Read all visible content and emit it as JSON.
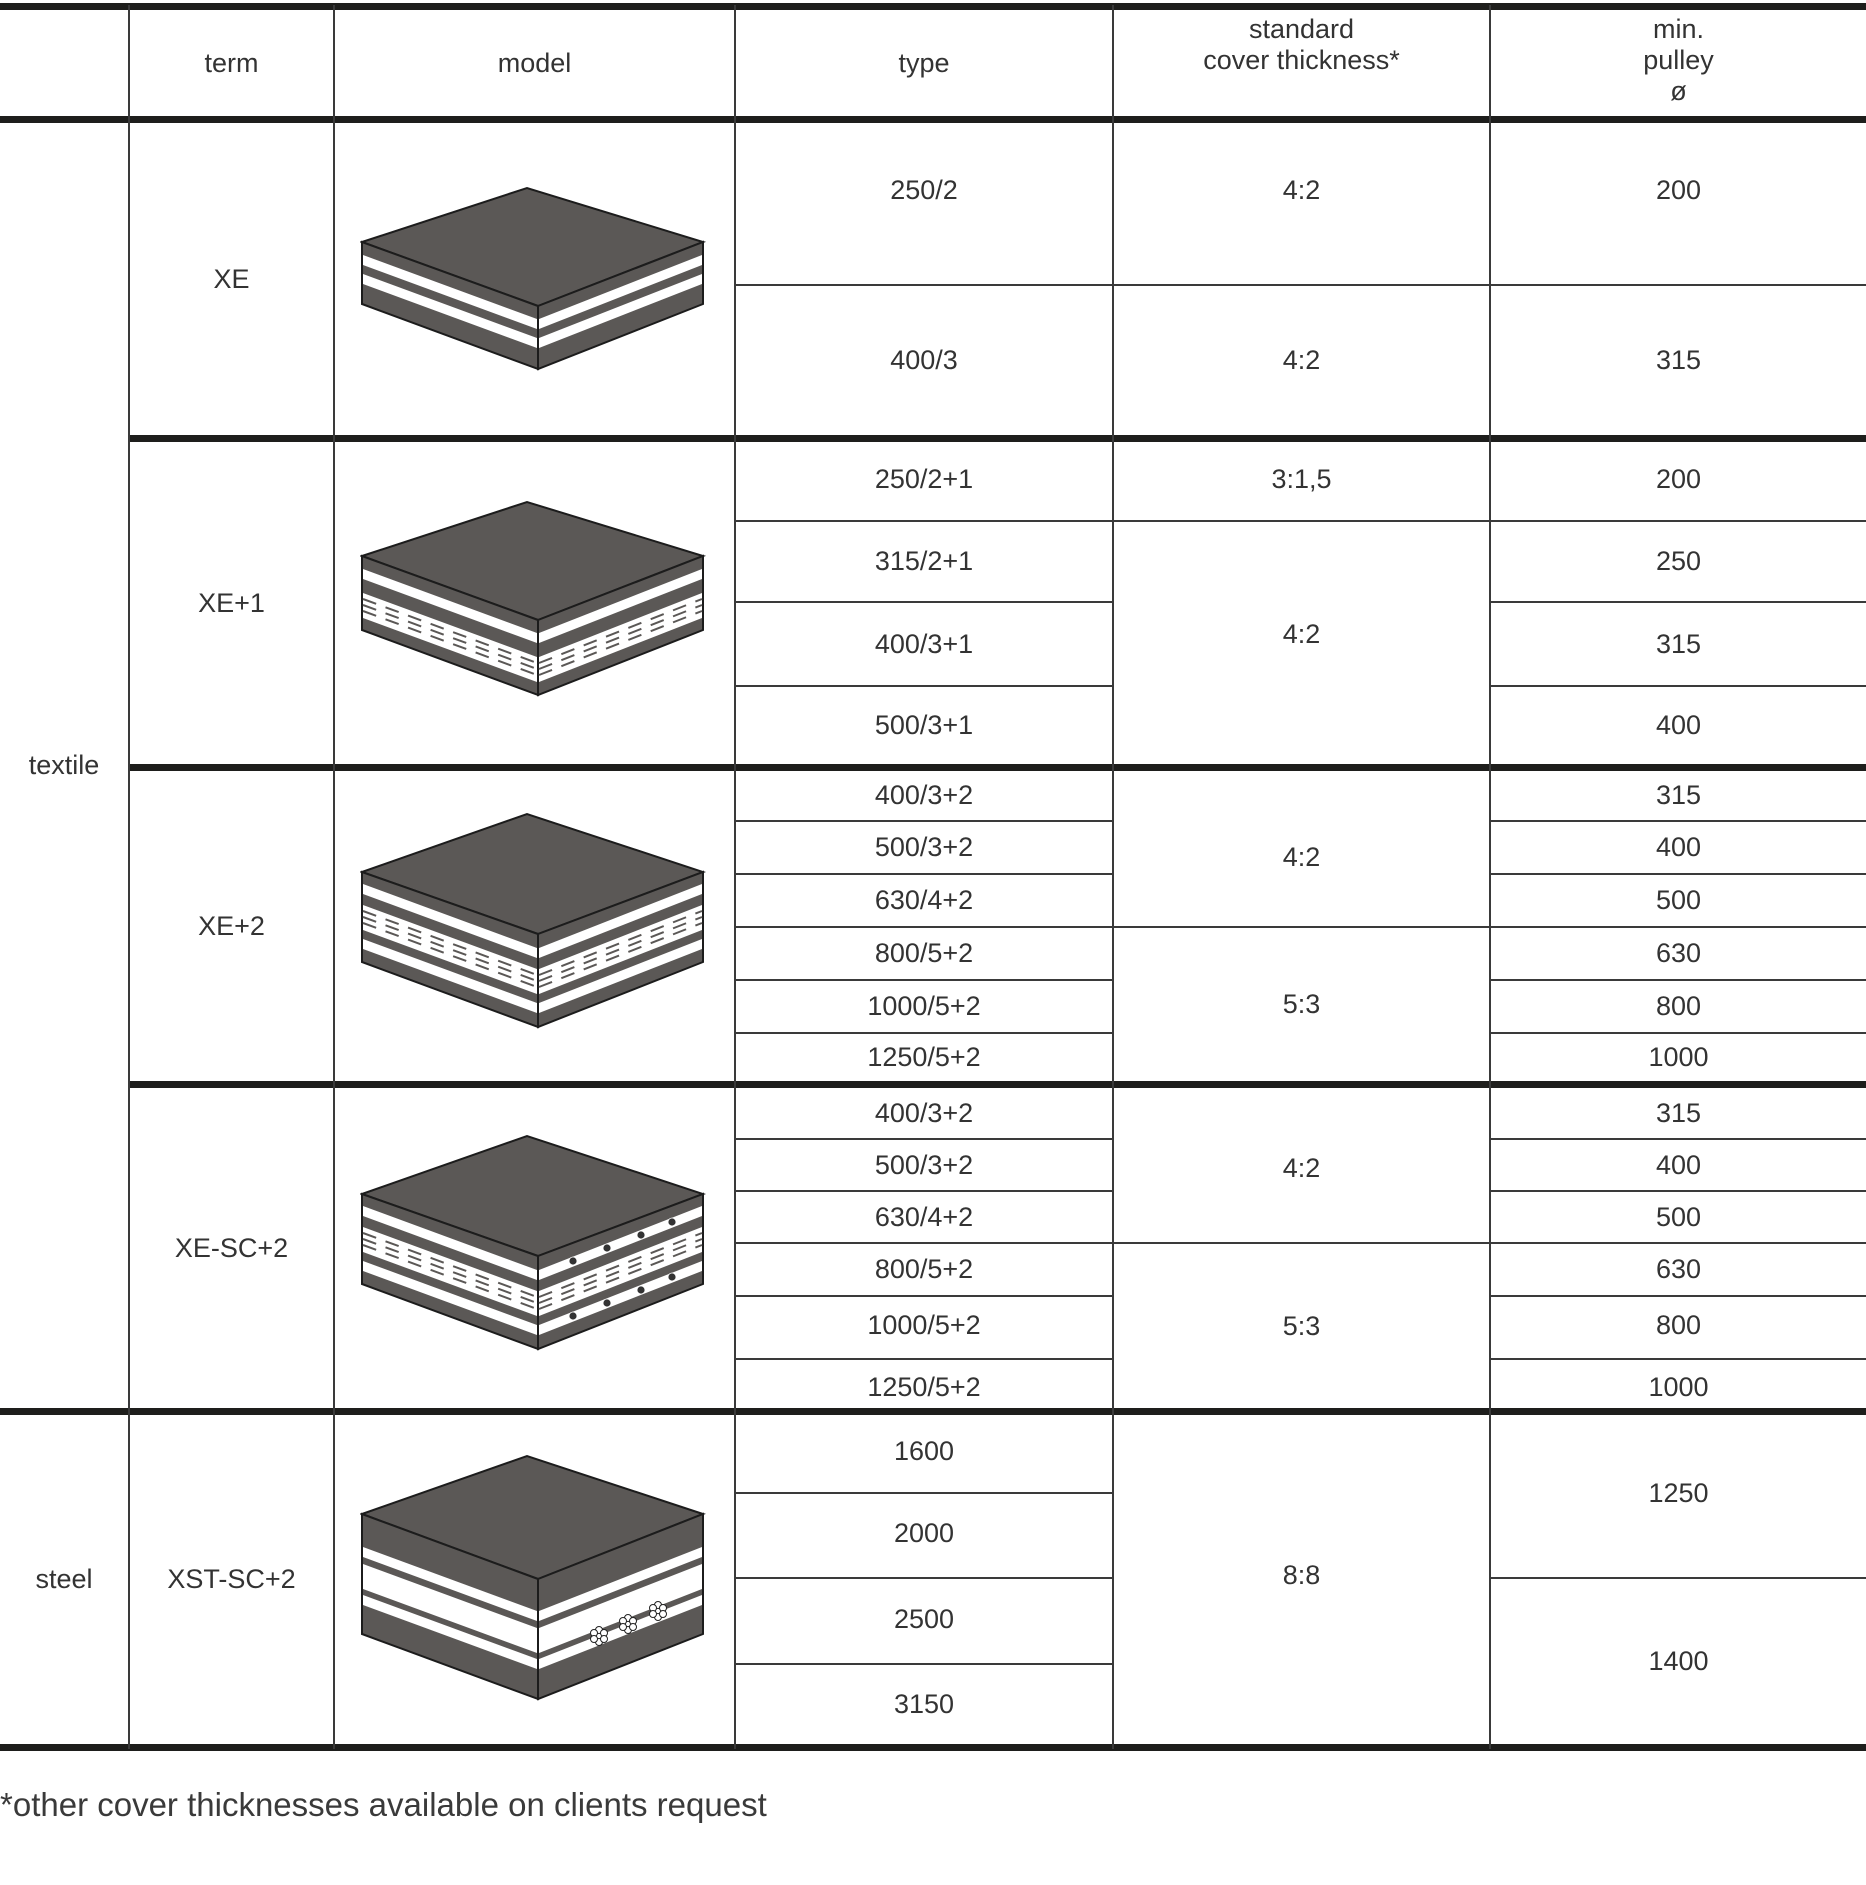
{
  "headers": {
    "category": "",
    "term": "term",
    "model": "model",
    "type": "type",
    "cover_line1": "standard",
    "cover_line2": "cover thickness*",
    "pulley_line1": "min.",
    "pulley_line2": "pulley",
    "pulley_line3": "ø"
  },
  "categories": {
    "textile": "textile",
    "steel": "steel"
  },
  "groups": [
    {
      "term": "XE",
      "model_icon": "belt-2-ply-icon",
      "types": [
        "250/2",
        "400/3"
      ],
      "covers": [
        "4:2",
        "4:2"
      ],
      "pulleys": [
        "200",
        "315"
      ]
    },
    {
      "term": "XE+1",
      "model_icon": "belt-ply-plus-breaker-icon",
      "types": [
        "250/2+1",
        "315/2+1",
        "400/3+1",
        "500/3+1"
      ],
      "covers": [
        "3:1,5",
        "4:2"
      ],
      "pulleys": [
        "200",
        "250",
        "315",
        "400"
      ]
    },
    {
      "term": "XE+2",
      "model_icon": "belt-ply-plus-2-breakers-icon",
      "types": [
        "400/3+2",
        "500/3+2",
        "630/4+2",
        "800/5+2",
        "1000/5+2",
        "1250/5+2"
      ],
      "covers": [
        "4:2",
        "5:3"
      ],
      "pulleys": [
        "315",
        "400",
        "500",
        "630",
        "800",
        "1000"
      ]
    },
    {
      "term": "XE-SC+2",
      "model_icon": "belt-ply-steel-cord-breakers-icon",
      "types": [
        "400/3+2",
        "500/3+2",
        "630/4+2",
        "800/5+2",
        "1000/5+2",
        "1250/5+2"
      ],
      "covers": [
        "4:2",
        "5:3"
      ],
      "pulleys": [
        "315",
        "400",
        "500",
        "630",
        "800",
        "1000"
      ]
    },
    {
      "term": "XST-SC+2",
      "model_icon": "belt-steel-cord-icon",
      "types": [
        "1600",
        "2000",
        "2500",
        "3150"
      ],
      "covers": [
        "8:8"
      ],
      "pulleys": [
        "1250",
        "1400"
      ]
    }
  ],
  "footnote": "*other cover thicknesses available on clients request"
}
